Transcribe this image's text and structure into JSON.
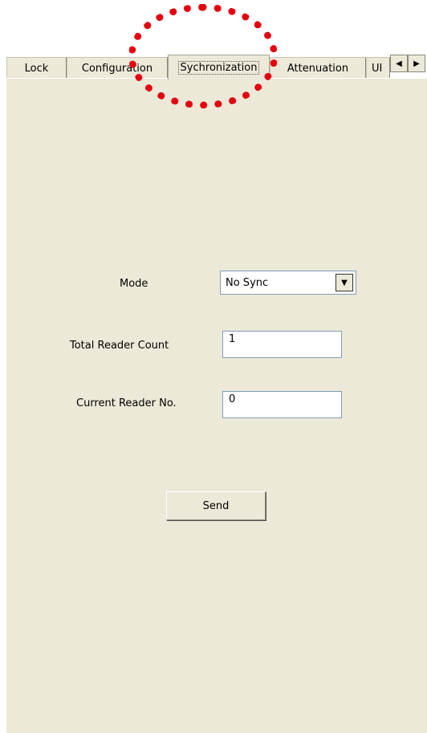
{
  "tabs": [
    {
      "label": "Lock"
    },
    {
      "label": "Configuration"
    },
    {
      "label": "Sychronization"
    },
    {
      "label": "Attenuation"
    },
    {
      "label": "UI"
    }
  ],
  "scroll_buttons": {
    "left": "◀",
    "right": "▶"
  },
  "form": {
    "mode_label": "Mode",
    "mode_value": "No Sync",
    "total_label": "Total Reader Count",
    "total_value": "1",
    "current_label": "Current Reader No.",
    "current_value": "0",
    "send_label": "Send"
  },
  "colors": {
    "panel": "#ece9d8",
    "annotation": "#e3000f"
  }
}
